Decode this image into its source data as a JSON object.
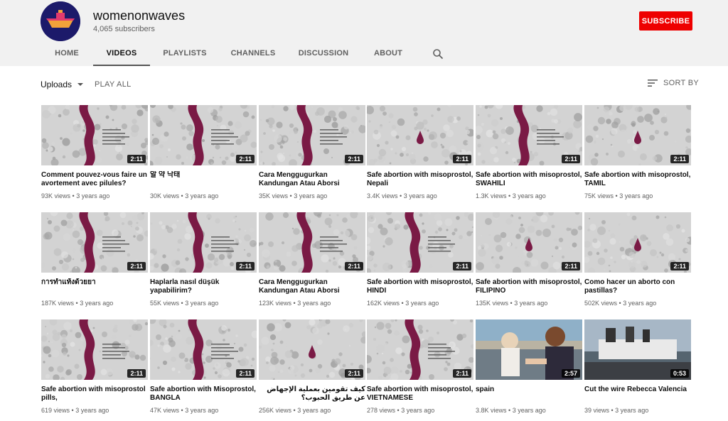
{
  "channel": {
    "name": "womenonwaves",
    "subscribers": "4,065 subscribers",
    "subscribe_label": "SUBSCRIBE"
  },
  "tabs": [
    {
      "label": "HOME"
    },
    {
      "label": "VIDEOS",
      "active": true
    },
    {
      "label": "PLAYLISTS"
    },
    {
      "label": "CHANNELS"
    },
    {
      "label": "DISCUSSION"
    },
    {
      "label": "ABOUT"
    }
  ],
  "toolbar": {
    "uploads_label": "Uploads",
    "play_all_label": "PLAY ALL",
    "sort_by_label": "SORT BY"
  },
  "icons": {
    "search": "search-icon",
    "sort": "sort-icon",
    "dropdown": "chevron-down-icon"
  },
  "colors": {
    "subscribe": "#ee0000",
    "wave": "#7a1a45",
    "header_bg": "#f1f1f1"
  },
  "videos": [
    {
      "title": "Comment pouvez-vous faire un avortement avec pilules?",
      "views": "93K views",
      "age": "3 years ago",
      "duration": "2:11",
      "thumb": "wave"
    },
    {
      "title": "알 약 낙태",
      "views": "30K views",
      "age": "3 years ago",
      "duration": "2:11",
      "thumb": "wave"
    },
    {
      "title": "Cara Menggugurkan Kandungan Atau Aborsi",
      "views": "35K views",
      "age": "3 years ago",
      "duration": "2:11",
      "thumb": "wave"
    },
    {
      "title": "Safe abortion with misoprostol, Nepali",
      "views": "3.4K views",
      "age": "3 years ago",
      "duration": "2:11",
      "thumb": "drop"
    },
    {
      "title": "Safe abortion with misoprostol, SWAHILI",
      "views": "1.3K views",
      "age": "3 years ago",
      "duration": "2:11",
      "thumb": "wave"
    },
    {
      "title": "Safe abortion with misoprostol, TAMIL",
      "views": "75K views",
      "age": "3 years ago",
      "duration": "2:11",
      "thumb": "drop"
    },
    {
      "title": "การทำแท้งด้วยยา",
      "views": "187K views",
      "age": "3 years ago",
      "duration": "2:11",
      "thumb": "wave"
    },
    {
      "title": "Haplarla nasıl düşük yapabilirim?",
      "views": "55K views",
      "age": "3 years ago",
      "duration": "2:11",
      "thumb": "wave"
    },
    {
      "title": "Cara Menggugurkan Kandungan Atau Aborsi",
      "views": "123K views",
      "age": "3 years ago",
      "duration": "2:11",
      "thumb": "wave"
    },
    {
      "title": "Safe abortion with misoprostol, HINDI",
      "views": "162K views",
      "age": "3 years ago",
      "duration": "2:11",
      "thumb": "wave"
    },
    {
      "title": "Safe abortion with misoprostol, FILIPINO",
      "views": "135K views",
      "age": "3 years ago",
      "duration": "2:11",
      "thumb": "drop"
    },
    {
      "title": "Como hacer un aborto con pastillas?",
      "views": "502K views",
      "age": "3 years ago",
      "duration": "2:11",
      "thumb": "drop"
    },
    {
      "title": "Safe abortion with misoprostol pills,",
      "views": "619 views",
      "age": "3 years ago",
      "duration": "2:11",
      "thumb": "wave"
    },
    {
      "title": "Safe abortion with Misoprostol, BANGLA",
      "views": "47K views",
      "age": "3 years ago",
      "duration": "2:11",
      "thumb": "wave"
    },
    {
      "title": "كيف تقومين بعملية الإجهاض عن طريق الحبوب؟",
      "views": "256K views",
      "age": "3 years ago",
      "duration": "2:11",
      "thumb": "drop"
    },
    {
      "title": "Safe abortion with misoprostol, VIETNAMESE",
      "views": "278 views",
      "age": "3 years ago",
      "duration": "2:11",
      "thumb": "wave"
    },
    {
      "title": "spain",
      "views": "3.8K views",
      "age": "3 years ago",
      "duration": "2:57",
      "thumb": "photo-dock"
    },
    {
      "title": "Cut the wire Rebecca Valencia",
      "views": "39 views",
      "age": "3 years ago",
      "duration": "0:53",
      "thumb": "photo-boat"
    }
  ]
}
